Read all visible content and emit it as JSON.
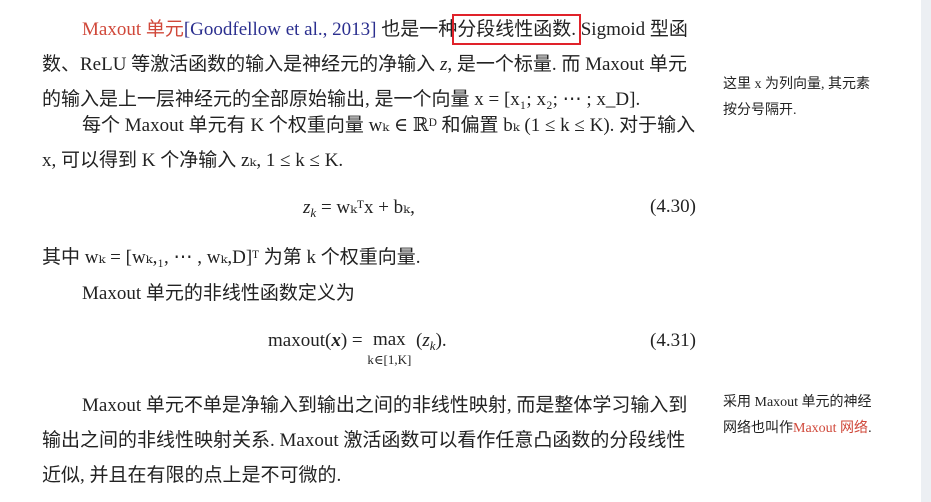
{
  "para1": {
    "term": "Maxout 单元",
    "citation": "[Goodfellow et al., 2013]",
    "text_a": " 也是一种",
    "highlight": "分段线性函数.",
    "text_b": " Sigmoid 型函数、ReLU 等激活函数的输入是神经元的净输入 ",
    "z": "z",
    "text_c": ", 是一个标量. 而 Maxout 单元的输入是上一层神经元的全部原始输出, 是一个向量 ",
    "vec": "x = [x₁; x₂; ⋯ ; x_D]."
  },
  "para2": {
    "text": "每个 Maxout 单元有 K 个权重向量 wₖ ∈ ℝᴰ 和偏置 bₖ (1 ≤ k ≤ K). 对于输入 x, 可以得到 K 个净输入 zₖ, 1 ≤ k ≤ K."
  },
  "eq430": {
    "lhs": "z",
    "rhs": "= wₖᵀx + bₖ,",
    "number": "(4.30)"
  },
  "para3": {
    "text": "其中 wₖ = [wₖ,₁, ⋯ , wₖ,D]ᵀ 为第 k 个权重向量."
  },
  "para4": {
    "text": "Maxout 单元的非线性函数定义为"
  },
  "eq431": {
    "lhs": "maxout(",
    "op": "max",
    "limit": "k∈[1,K]",
    "number": "(4.31)"
  },
  "para5": {
    "text": "Maxout 单元不单是净输入到输出之间的非线性映射, 而是整体学习输入到输出之间的非线性映射关系. Maxout 激活函数可以看作任意凸函数的分段线性近似, 并且在有限的点上是不可微的."
  },
  "note1": {
    "text": "这里 x 为列向量, 其元素按分号隔开."
  },
  "note2": {
    "text_a": "采用 Maxout 单元的神经网络也叫作",
    "term": "Maxout 网络",
    "end": "."
  },
  "colors": {
    "term": "#d0483a",
    "citation": "#2b2f8f",
    "highlight_box": "#e0222a"
  }
}
